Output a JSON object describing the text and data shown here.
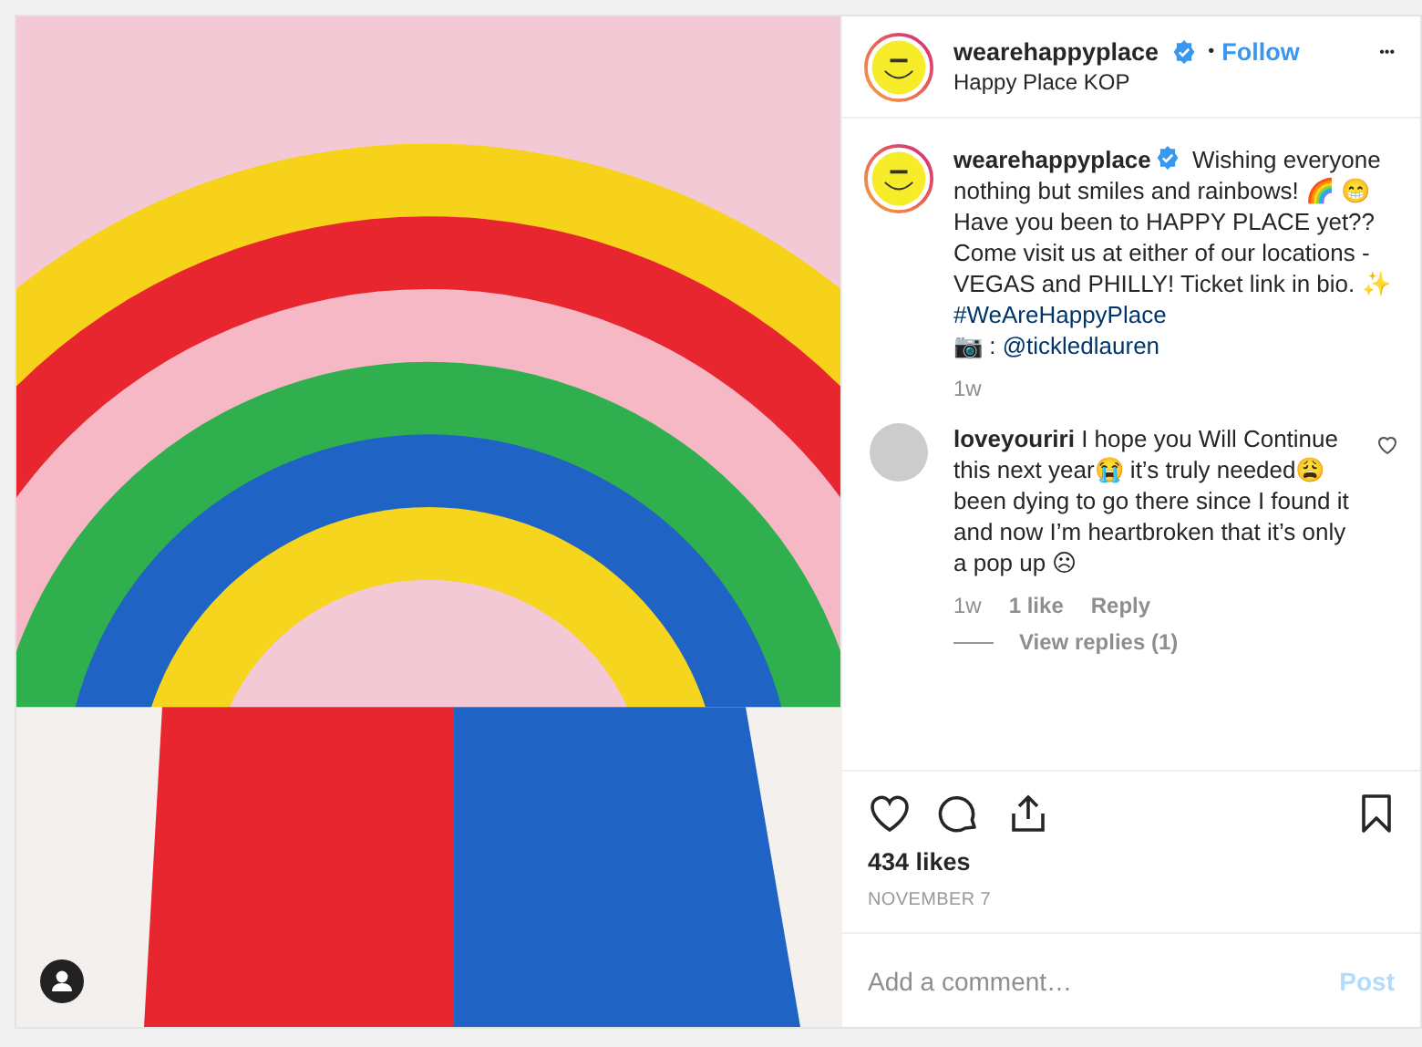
{
  "post": {
    "username": "wearehappyplace",
    "verified": true,
    "separator": "•",
    "follow": "Follow",
    "location": "Happy Place KOP",
    "more": "•••"
  },
  "caption": {
    "username": "wearehappyplace",
    "verified": true,
    "text": "Wishing everyone nothing but smiles and rainbows! 🌈 😁 Have you been to HAPPY PLACE yet?? Come visit us at either of our locations - VEGAS and PHILLY! Ticket link in bio. ✨ ",
    "hashtag": "#WeAreHappyPlace",
    "mention_prefix": "📷 : ",
    "mention": "@tickledlauren",
    "time": "1w"
  },
  "comments": [
    {
      "username": "loveyouriri",
      "text": "I hope you Will Continue this next year😭 it’s truly needed😩 been dying to go there since I found it and now I’m heartbroken that it’s only a pop up ☹",
      "liked": false,
      "time": "1w",
      "likes": "1 like",
      "reply": "Reply",
      "view_replies": "View replies (1)"
    }
  ],
  "actions": {
    "liked": false,
    "saved": false
  },
  "likes": "434 likes",
  "date": "NOVEMBER 7",
  "comment_box": {
    "placeholder": "Add a comment…",
    "post": "Post",
    "disabled": true
  }
}
